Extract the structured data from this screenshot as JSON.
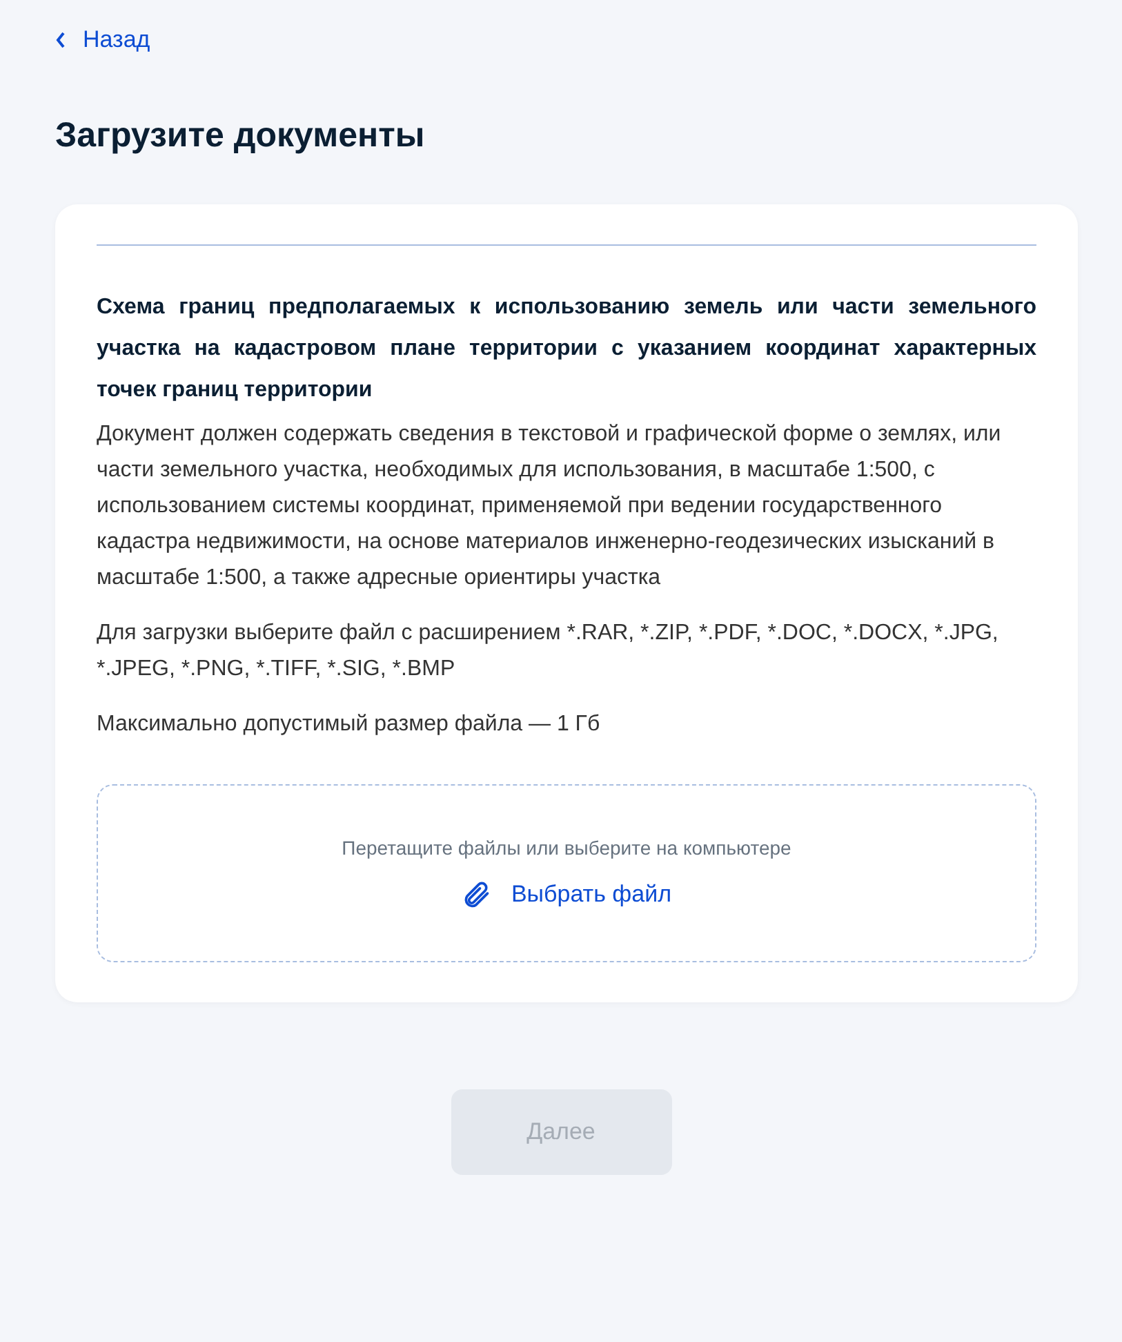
{
  "back_link": "Назад",
  "title": "Загрузите документы",
  "document": {
    "heading": "Схема границ предполагаемых к использованию земель или части земельного участка на кадастровом плане территории с указанием координат характерных точек границ территории",
    "description": "Документ должен содержать сведения в текстовой и графической форме о землях, или части земельного участка, необходимых для использования, в масштабе 1:500, с использованием системы координат, применяемой при ведении государственного кадастра недвижимости, на основе материалов инженерно-геодезических изысканий в масштабе 1:500, а также адресные ориентиры участка",
    "formats": "Для загрузки выберите файл с расширением *.RAR, *.ZIP, *.PDF, *.DOC, *.DOCX, *.JPG, *.JPEG, *.PNG, *.TIFF, *.SIG, *.BMP",
    "max_size": "Максимально допустимый размер файла — 1 Гб"
  },
  "dropzone": {
    "hint": "Перетащите файлы или выберите на компьютере",
    "button": "Выбрать файл"
  },
  "next_button": {
    "label": "Далее",
    "disabled": true
  }
}
